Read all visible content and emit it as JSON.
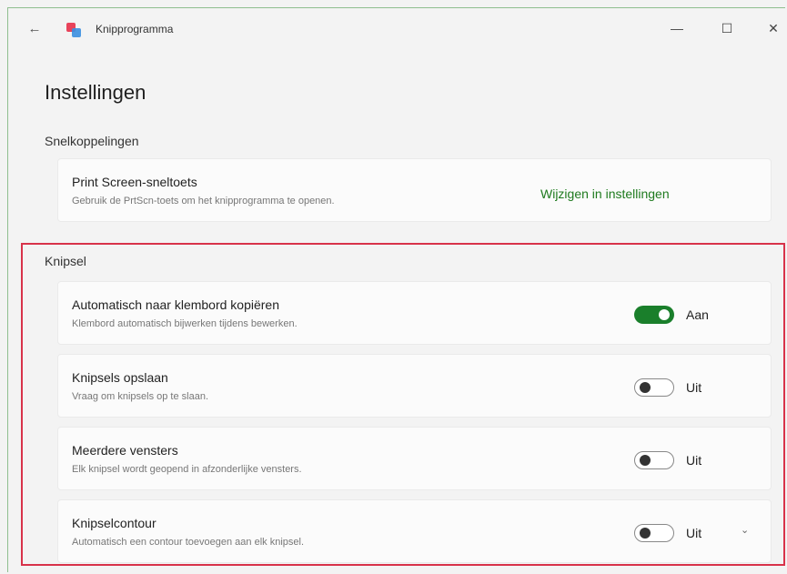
{
  "app": {
    "title": "Knipprogramma",
    "back_icon": "back-arrow-icon",
    "app_icon": "snipping-tool-icon",
    "window_buttons": {
      "minimize": "—",
      "maximize": "☐",
      "close": "✕"
    }
  },
  "page": {
    "title": "Instellingen"
  },
  "sections": {
    "shortcuts": {
      "heading": "Snelkoppelingen",
      "printscreen": {
        "title": "Print Screen-sneltoets",
        "description": "Gebruik de PrtScn-toets om het knipprogramma te openen.",
        "link_label": "Wijzigen in instellingen"
      }
    },
    "snip": {
      "heading": "Knipsel",
      "items": [
        {
          "title": "Automatisch naar klembord kopiëren",
          "description": "Klembord automatisch bijwerken tijdens bewerken.",
          "state": "Aan",
          "on": true
        },
        {
          "title": "Knipsels opslaan",
          "description": "Vraag om knipsels op te slaan.",
          "state": "Uit",
          "on": false
        },
        {
          "title": "Meerdere vensters",
          "description": "Elk knipsel wordt geopend in afzonderlijke vensters.",
          "state": "Uit",
          "on": false
        },
        {
          "title": "Knipselcontour",
          "description": "Automatisch een contour toevoegen aan elk knipsel.",
          "state": "Uit",
          "on": false,
          "expandable": true
        }
      ]
    }
  },
  "colors": {
    "accent": "#1a7f2b",
    "link": "#1e7a1e",
    "highlight_border": "#d8324a"
  }
}
